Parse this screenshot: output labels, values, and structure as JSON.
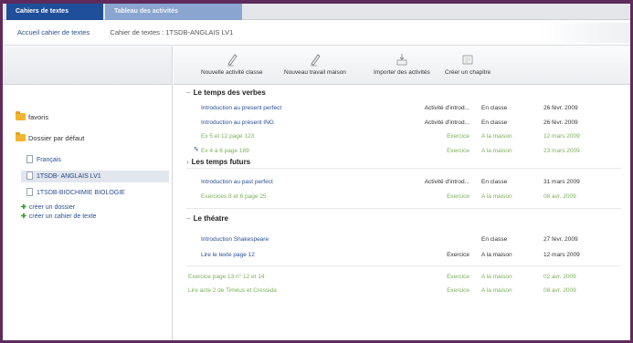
{
  "tabs": [
    {
      "label": "Cahiers de textes"
    },
    {
      "label": "Tableau des activités"
    }
  ],
  "breadcrumb": {
    "root": "Accueil cahier de textes",
    "current": "Cahier de textes : 1TSDB-ANGLAIS LV1"
  },
  "sidebar": {
    "folders": [
      {
        "label": "favoris"
      },
      {
        "label": "Dossier par défaut"
      }
    ],
    "notebooks": [
      {
        "label": "Français"
      },
      {
        "label": "1TSDB- ANGLAIS LV1"
      },
      {
        "label": "1TSDB-BIOCHIMIE BIOLOGIE"
      }
    ],
    "actions": [
      {
        "label": "créer un dossier"
      },
      {
        "label": "créer un cahier de texte"
      }
    ]
  },
  "toolbar": {
    "tools": [
      {
        "label": "Nouvelle activité classe",
        "icon": "pencil-icon"
      },
      {
        "label": "Nouveau travail maison",
        "icon": "pencil-icon"
      },
      {
        "label": "Importer des activités",
        "icon": "import-icon"
      },
      {
        "label": "Créer un chapitre",
        "icon": "chapter-icon"
      }
    ]
  },
  "sections": [
    {
      "title": "Le temps des verbes",
      "rows": [
        {
          "title": "Introduction au present perfect",
          "type": "Activité d'introd...",
          "where": "En classe",
          "date": "26 févr. 2009",
          "style": "blue"
        },
        {
          "title": "Introduction au présent ING",
          "type": "Activité d'introd...",
          "where": "En classe",
          "date": "26 févr. 2009",
          "style": "blue"
        },
        {
          "title": "Ex 5 et 12 page 123",
          "type": "Exercice",
          "where": "A la maison",
          "date": "12 mars 2009",
          "style": "green"
        },
        {
          "title": "Ex 4 à 6 page 189",
          "type": "Exercice",
          "where": "A la maison",
          "date": "23 mars 2009",
          "style": "green"
        }
      ]
    },
    {
      "title": "Les temps futurs",
      "rows": [
        {
          "title": "Introduction au past perfect",
          "type": "Activité d'introd...",
          "where": "En classe",
          "date": "31 mars 2009",
          "style": "blue"
        },
        {
          "title": "Exercices 8 et 6 page 25",
          "type": "Exercice",
          "where": "A la maison",
          "date": "08 avr. 2009",
          "style": "green"
        }
      ]
    },
    {
      "title": "Le théatre",
      "rows": [
        {
          "title": "Introduction Shakespeare",
          "type": "",
          "where": "En classe",
          "date": "27 févr. 2009",
          "style": "blue"
        },
        {
          "title": "Lire le texte page 12",
          "type": "Exercice",
          "where": "A la maison",
          "date": "12 mars 2009",
          "style": "blue"
        },
        {
          "title": "Exercice page 13 n° 12 et 14",
          "type": "Exercice",
          "where": "A la maison",
          "date": "02 avr. 2009",
          "style": "green"
        },
        {
          "title": "Lire acte 2 de Timéus et Cressida",
          "type": "Exercice",
          "where": "A la maison",
          "date": "08 avr. 2009",
          "style": "green"
        }
      ]
    }
  ]
}
